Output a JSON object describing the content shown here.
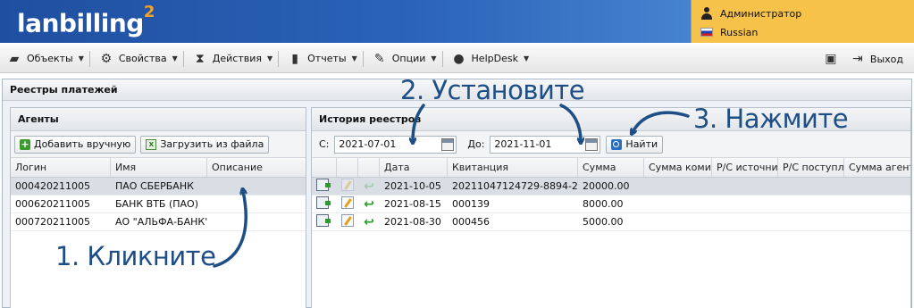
{
  "header": {
    "logo_text": "lanbilling",
    "logo_sup": "2",
    "user": "Администратор",
    "language": "Russian"
  },
  "menu": {
    "items": [
      {
        "label": "Объекты",
        "icon": "objects-icon"
      },
      {
        "label": "Свойства",
        "icon": "gear-icon"
      },
      {
        "label": "Действия",
        "icon": "hourglass-icon"
      },
      {
        "label": "Отчеты",
        "icon": "bar-chart-icon"
      },
      {
        "label": "Опции",
        "icon": "wrench-icon"
      },
      {
        "label": "HelpDesk",
        "icon": "chat-icon"
      }
    ],
    "logout_label": "Выход"
  },
  "panel": {
    "title": "Реестры платежей"
  },
  "agents": {
    "title": "Агенты",
    "add_button": "Добавить вручную",
    "load_button": "Загрузить из файла",
    "columns": [
      "Логин",
      "Имя",
      "Описание"
    ],
    "rows": [
      {
        "login": "000420211005",
        "name": "ПАО СБЕРБАНК",
        "desc": ""
      },
      {
        "login": "000620211005",
        "name": "БАНК ВТБ (ПАО)",
        "desc": ""
      },
      {
        "login": "000720211005",
        "name": "АО \"АЛЬФА-БАНК\"",
        "desc": ""
      }
    ]
  },
  "history": {
    "title": "История реестров",
    "from_label": "С:",
    "from_value": "2021-07-01",
    "to_label": "До:",
    "to_value": "2021-11-01",
    "find_button": "Найти",
    "columns": [
      "Дата",
      "Квитанция",
      "Сумма",
      "Сумма комис",
      "Р/С источник",
      "Р/С поступле",
      "Сумма агенто"
    ],
    "rows": [
      {
        "date": "2021-10-05",
        "receipt": "20211047124729-8894-2...",
        "sum": "20000.00"
      },
      {
        "date": "2021-08-15",
        "receipt": "000139",
        "sum": "8000.00"
      },
      {
        "date": "2021-08-30",
        "receipt": "000456",
        "sum": "5000.00"
      }
    ]
  },
  "annotations": {
    "step1": "1. Кликните",
    "step2": "2. Установите",
    "step3": "3. Нажмите",
    "color": "#1d4e86"
  }
}
